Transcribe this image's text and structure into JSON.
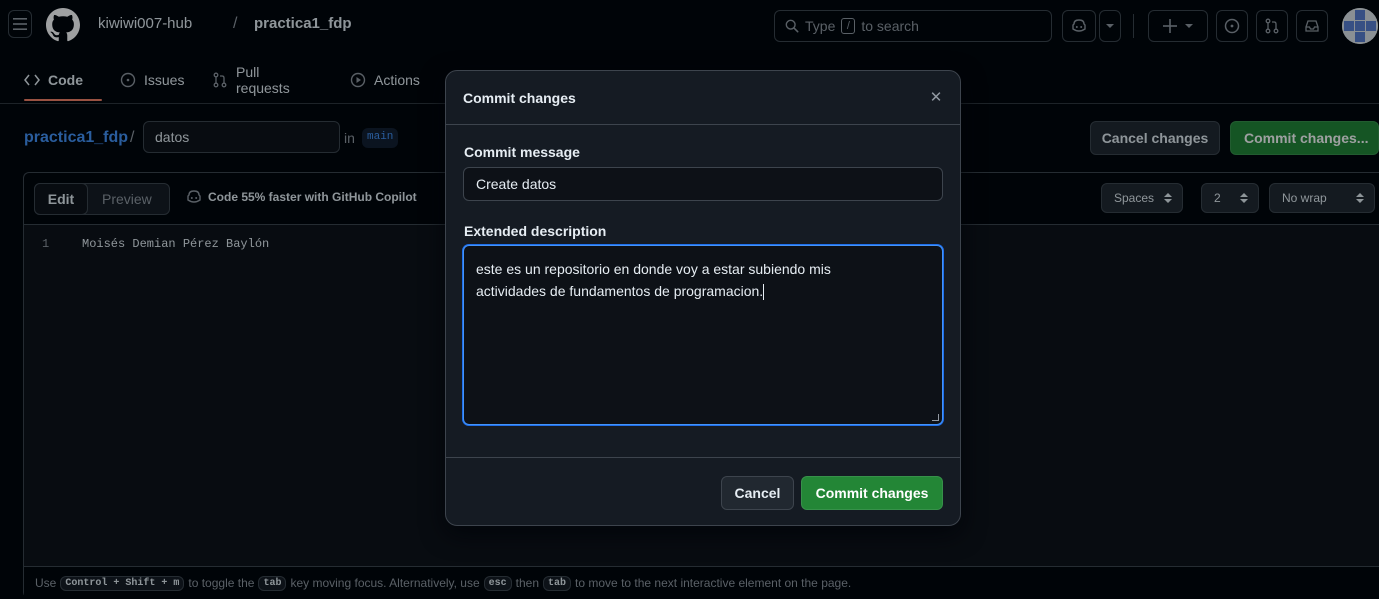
{
  "header": {
    "owner": "kiwiwi007-hub",
    "separator": "/",
    "repo": "practica1_fdp",
    "search_placeholder_pre": "Type",
    "search_key": "/",
    "search_placeholder_post": "to search"
  },
  "tabs": [
    {
      "label": "Code",
      "icon": "code-icon",
      "active": true
    },
    {
      "label": "Issues",
      "icon": "issue-icon"
    },
    {
      "label": "Pull requests",
      "icon": "pull-request-icon"
    },
    {
      "label": "Actions",
      "icon": "actions-play-icon"
    }
  ],
  "breadcrumb": {
    "repo": "practica1_fdp",
    "slash": "/",
    "filename": "datos",
    "in_text": "in",
    "branch": "main"
  },
  "actions": {
    "cancel_changes": "Cancel changes",
    "commit_changes": "Commit changes..."
  },
  "editor": {
    "edit_tab": "Edit",
    "preview_tab": "Preview",
    "copilot_hint": "Code 55% faster with GitHub Copilot",
    "indent_mode": "Spaces",
    "indent_size": "2",
    "wrap_mode": "No wrap",
    "lines": [
      {
        "number": "1",
        "text": "Moisés Demian Pérez Baylón"
      }
    ],
    "footer": {
      "t1": "Use",
      "k1": "Control + Shift + m",
      "t2": "to toggle the",
      "k2": "tab",
      "t3": "key moving focus. Alternatively, use",
      "k3": "esc",
      "t4": "then",
      "k4": "tab",
      "t5": "to move to the next interactive element on the page."
    }
  },
  "dialog": {
    "title": "Commit changes",
    "close_glyph": "✕",
    "message_label": "Commit message",
    "message_value": "Create datos",
    "description_label": "Extended description",
    "description_value": "este es un repositorio en donde voy a estar subiendo mis\nactividades de fundamentos de programacion.",
    "cancel": "Cancel",
    "commit": "Commit changes"
  },
  "colors": {
    "background": "#010409",
    "canvas": "#0d1117",
    "overlay_panel": "#151b23",
    "accent_blue": "#4493f8",
    "success_green": "#238636",
    "tab_underline": "#f78166"
  }
}
